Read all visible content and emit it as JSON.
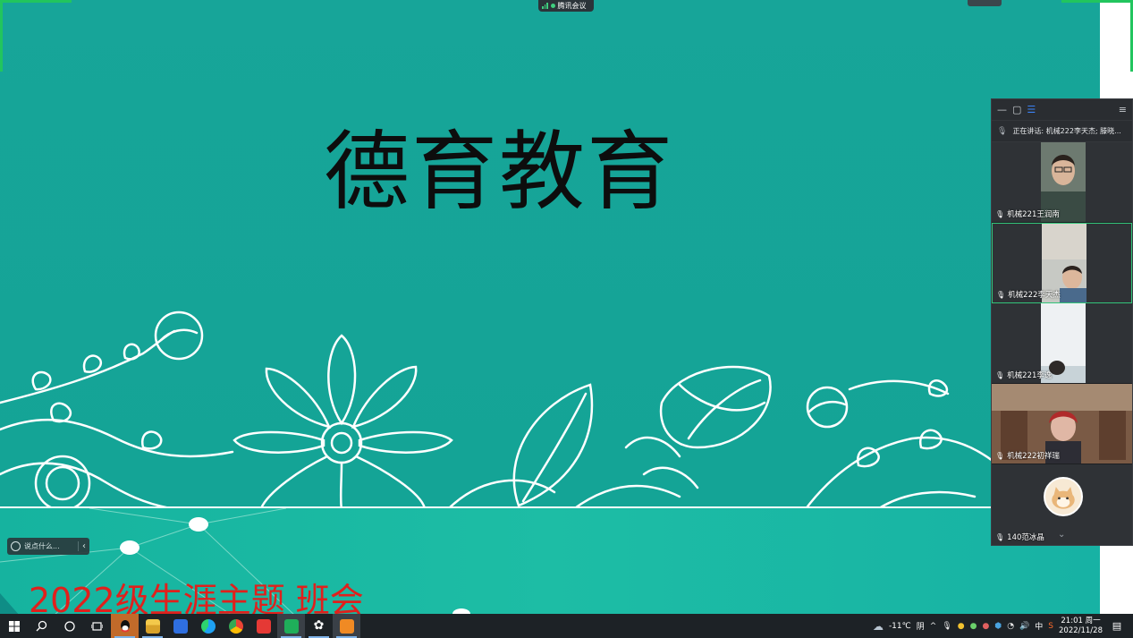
{
  "meeting": {
    "app_name": "腾讯会议",
    "speaking_text": "正在讲话: 机械222李天杰; 滕晓...",
    "participants": [
      {
        "name": "机械221王润南",
        "mic": "on",
        "video": "camera"
      },
      {
        "name": "机械222李天杰",
        "mic": "on",
        "video": "camera",
        "selected": true
      },
      {
        "name": "机械221李逸",
        "mic": "muted",
        "video": "camera"
      },
      {
        "name": "机械222初祥瑞",
        "mic": "muted",
        "video": "camera"
      },
      {
        "name": "140范冰晶",
        "mic": "muted",
        "video": "avatar"
      }
    ],
    "chat_placeholder": "说点什么...",
    "colors": {
      "accent": "#33c47a",
      "panel_bg": "#2a2d31"
    }
  },
  "slide": {
    "title": "德育教育",
    "subtitle": "2022级生涯主题 班会",
    "colors": {
      "background": "#12a898",
      "title": "#0d0d0d",
      "subtitle": "#e0201c"
    }
  },
  "taskbar": {
    "apps": [
      "windows-start",
      "search",
      "cortana",
      "task-view",
      "qq",
      "file-explorer",
      "feishu",
      "edge",
      "chrome",
      "wps",
      "tencent-meeting",
      "settings-app",
      "video-player"
    ],
    "weather": {
      "temp": "-11℃",
      "condition": "阴"
    },
    "ime": "中",
    "time": "21:01 周一",
    "date": "2022/11/28"
  }
}
